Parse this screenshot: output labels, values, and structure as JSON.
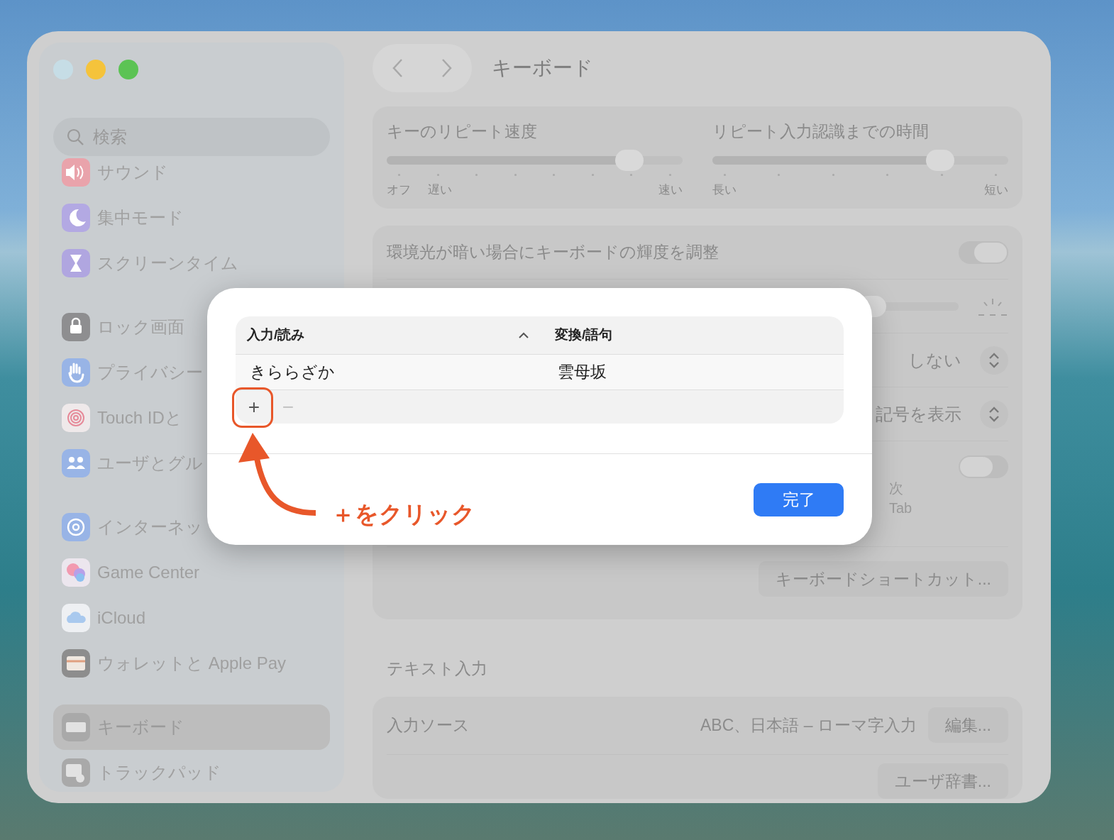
{
  "sidebar": {
    "search": {
      "placeholder": "検索"
    },
    "groups": [
      {
        "items": [
          {
            "label": "サウンド",
            "color": "#e9a3ab",
            "selected": false
          },
          {
            "label": "集中モード",
            "color": "#b3a9e3",
            "selected": false
          },
          {
            "label": "スクリーンタイム",
            "color": "#b0a6e0",
            "selected": false
          }
        ]
      },
      {
        "items": [
          {
            "label": "ロック画面",
            "color": "#8e8e90",
            "selected": false
          },
          {
            "label": "プライバシー",
            "color": "#98b4e6",
            "selected": false
          },
          {
            "label": "Touch IDと",
            "color": "#efe9ea",
            "selected": false
          },
          {
            "label": "ユーザとグル",
            "color": "#98b4e6",
            "selected": false
          }
        ]
      },
      {
        "items": [
          {
            "label": "インターネッ",
            "color": "#98b4e6",
            "selected": false
          },
          {
            "label": "Game Center",
            "color": "#ece6ee",
            "selected": false
          },
          {
            "label": "iCloud",
            "color": "#eef0f3",
            "selected": false
          },
          {
            "label": "ウォレットと Apple Pay",
            "color": "#8d8d8d",
            "selected": false
          }
        ]
      },
      {
        "items": [
          {
            "label": "キーボード",
            "color": "#a9a9a9",
            "selected": true
          },
          {
            "label": "トラックパッド",
            "color": "#a9a9a9",
            "selected": false
          }
        ]
      }
    ]
  },
  "toolbar": {
    "title": "キーボード"
  },
  "repeat_card": {
    "sliders": [
      {
        "title": "キーのリピート速度",
        "level": 0.82,
        "left_labels": [
          "オフ",
          "遅い"
        ],
        "right_label": "速い"
      },
      {
        "title": "リピート入力認識までの時間",
        "level": 0.77,
        "left_labels": [
          "長い"
        ],
        "right_label": "短い"
      }
    ]
  },
  "settings_card": {
    "rows": [
      {
        "kind": "toggle",
        "label": "環境光が暗い場合にキーボードの輝度を調整",
        "on": true
      },
      {
        "kind": "brightness",
        "level": 0.66
      },
      {
        "kind": "popup",
        "value": "しない"
      },
      {
        "kind": "popup",
        "value": "記号を表示"
      },
      {
        "kind": "toggle",
        "on": false,
        "description": [
          "次",
          "Tab"
        ]
      },
      {
        "kind": "button",
        "label": "キーボードショートカット..."
      }
    ]
  },
  "text_input": {
    "heading": "テキスト入力",
    "rows": [
      {
        "kind": "source",
        "label": "入力ソース",
        "value": "ABC、日本語 – ローマ字入力",
        "button": "編集..."
      },
      {
        "kind": "button",
        "button": "ユーザ辞書..."
      }
    ]
  },
  "dialog": {
    "columns": [
      {
        "label": "入力/読み",
        "sorted": true
      },
      {
        "label": "変換/語句"
      }
    ],
    "rows": [
      {
        "cells": [
          "きららざか",
          "雲母坂"
        ]
      }
    ],
    "add_button": "+",
    "remove_button": "−",
    "remove_disabled": true,
    "done_button": "完了"
  },
  "annotation": {
    "text": "＋をクリック"
  }
}
